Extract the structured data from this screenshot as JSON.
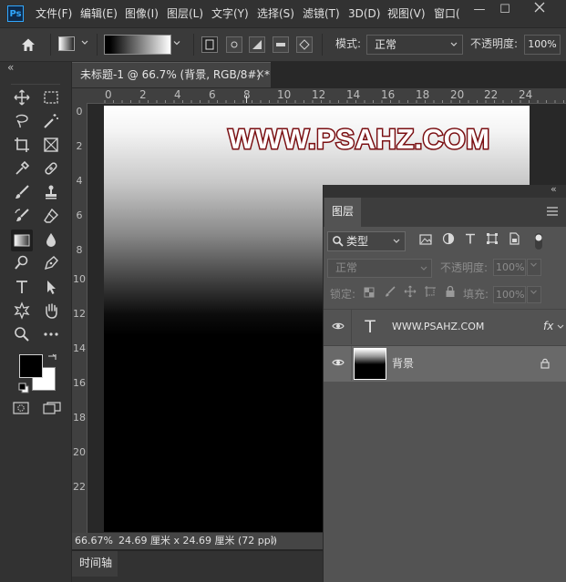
{
  "app": {
    "logo": "Ps"
  },
  "menu": [
    "文件(F)",
    "编辑(E)",
    "图像(I)",
    "图层(L)",
    "文字(Y)",
    "选择(S)",
    "滤镜(T)",
    "3D(D)",
    "视图(V)",
    "窗口("
  ],
  "window_controls": {
    "minimize": "—",
    "maximize": "☐"
  },
  "options_bar": {
    "mode_label": "模式:",
    "mode_value": "正常",
    "opacity_label": "不透明度:",
    "opacity_value": "100%"
  },
  "collapse_glyph": "«",
  "document": {
    "tab_title": "未标题-1 @ 66.7% (背景, RGB/8#) *",
    "close": "×"
  },
  "rulers": {
    "horizontal": [
      "0",
      "2",
      "4",
      "6",
      "8",
      "10",
      "12",
      "14",
      "16",
      "18",
      "20",
      "22",
      "24"
    ],
    "vertical": [
      "0",
      "2",
      "4",
      "6",
      "8",
      "10",
      "12",
      "14",
      "16",
      "18",
      "20",
      "22"
    ]
  },
  "canvas": {
    "watermark_text": "WWW.PSAHZ.COM"
  },
  "status": {
    "zoom": "66.67%",
    "doc_info": "24.69 厘米 x 24.69 厘米 (72 ppi)",
    "arrow": "〉"
  },
  "timeline": {
    "label": "时间轴"
  },
  "layers_panel": {
    "tab": "图层",
    "filter_label": "类型",
    "blend_mode": "正常",
    "opacity_label": "不透明度:",
    "opacity_value": "100%",
    "lock_label": "锁定:",
    "fill_label": "填充:",
    "fill_value": "100%",
    "layers": [
      {
        "name": "WWW.PSAHZ.COM",
        "type": "text",
        "badge": "fx",
        "thumb_glyph": "T"
      },
      {
        "name": "背景",
        "type": "background",
        "locked": true
      }
    ]
  },
  "colors": {
    "accent": "#31a8ff",
    "watermark_outline": "#7a0f12",
    "panel_bg": "#535353",
    "selected_layer_bg": "#696969"
  }
}
